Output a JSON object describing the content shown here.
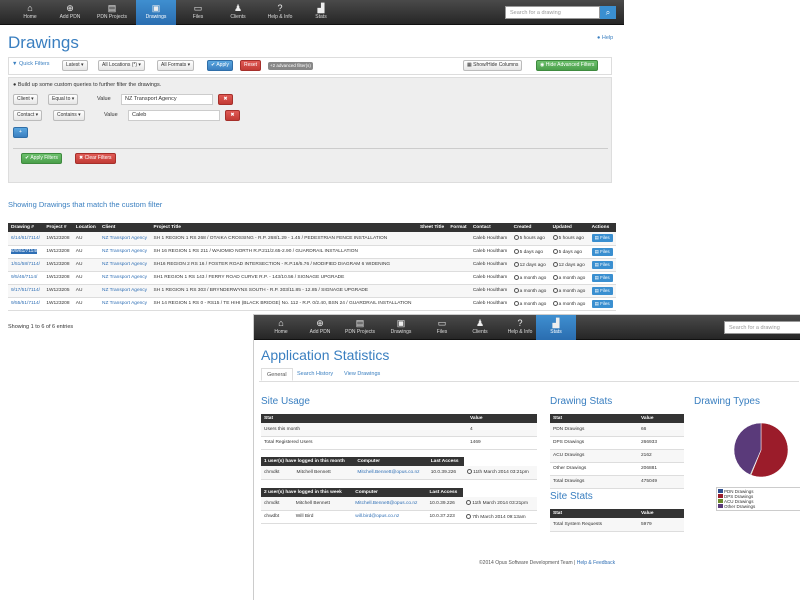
{
  "nav1": {
    "items": [
      {
        "label": "Home",
        "icon": "home-icon",
        "glyph": "⌂"
      },
      {
        "label": "Add PDN",
        "icon": "plus-circle-icon",
        "glyph": "⊕"
      },
      {
        "label": "PDN Projects",
        "icon": "document-icon",
        "glyph": "▤"
      },
      {
        "label": "Drawings",
        "icon": "folder-icon",
        "glyph": "▣"
      },
      {
        "label": "Files",
        "icon": "files-icon",
        "glyph": "▭"
      },
      {
        "label": "Clients",
        "icon": "users-icon",
        "glyph": "♟"
      },
      {
        "label": "Help & Info",
        "icon": "help-icon",
        "glyph": "?"
      },
      {
        "label": "Stats",
        "icon": "chart-icon",
        "glyph": "▟"
      }
    ],
    "search_placeholder": "Search for a drawing"
  },
  "drawings": {
    "title": "Drawings",
    "help": "Help",
    "quick_filters": "Quick Filters",
    "latest": "Latest",
    "all_locations": "All Locations (*)",
    "all_formats": "All Formats",
    "apply": "Apply",
    "reset": "Reset",
    "advanced_badge": "+2 advanced filter(s)",
    "show_hide": "Show/Hide Columns",
    "hide_advanced": "Hide Advanced Filters",
    "build_hint": "Build up some custom queries to further filter the drawings.",
    "filters": [
      {
        "field": "Client",
        "op": "Equal to",
        "value_label": "Value",
        "value": "NZ Transport Agency"
      },
      {
        "field": "Contact",
        "op": "Contains",
        "value_label": "Value",
        "value": "Caleb"
      }
    ],
    "apply_filters": "Apply Filters",
    "clear_filters": "Clear Filters",
    "showing_title": "Showing Drawings that match the custom filter",
    "columns": [
      "Drawing #",
      "Project #",
      "Location",
      "Client",
      "Project Title",
      "Sheet Title",
      "Format",
      "Contact",
      "Created",
      "Updated",
      "Actions"
    ],
    "rows": [
      {
        "d": "6/14/61/7114/",
        "p": "1W123208",
        "loc": "AU",
        "client": "NZ Transport Agency",
        "title": "SH 1 REGION 1 RS 268 / OTAIKA CROSSING - R.P. 268/1.29 - 1.45 / PEDESTRIAN FENCE INSTALLATION",
        "contact": "Caleb Houltham",
        "created": "5 hours ago",
        "updated": "5 hours ago",
        "action": "Files"
      },
      {
        "d": "6/9/61/7114/",
        "p": "1W123208",
        "loc": "AU",
        "client": "NZ Transport Agency",
        "title": "SH 16 REGION 1 RS 211 / WAIOMIO NORTH R.P.211/2.65-2.90 / GUARDRAIL INSTALLATION",
        "contact": "Caleb Houltham",
        "created": "5 days ago",
        "updated": "5 days ago",
        "action": "Files"
      },
      {
        "d": "1/51/58/7114/",
        "p": "1W123208",
        "loc": "AU",
        "client": "NZ Transport Agency",
        "title": "SH16 REGION 2 RS 16 / FOSTER ROAD INTERSECTION - R.P.16/5.76 / MODIFIED DIAGRAM 6 WIDENING",
        "contact": "Caleb Houltham",
        "created": "12 days ago",
        "updated": "12 days ago",
        "action": "Files"
      },
      {
        "d": "9/5/46/7114/",
        "p": "1W123208",
        "loc": "AU",
        "client": "NZ Transport Agency",
        "title": "SH1 REGION 1 RS 143 / FERRY ROAD CURVE R.P. - 143/10.56 / SIGNAGE UPGRADE",
        "contact": "Caleb Houltham",
        "created": "a month ago",
        "updated": "a month ago",
        "action": "Files"
      },
      {
        "d": "9/17/51/7114/",
        "p": "1W123205",
        "loc": "AU",
        "client": "NZ Transport Agency",
        "title": "SH 1 REGION 1 RS 303 / BRYNDERWYNS SOUTH - R.P. 303/11.85 - 12.85 / SIGNAGE UPGRADE",
        "contact": "Caleb Houltham",
        "created": "a month ago",
        "updated": "a month ago",
        "action": "Files"
      },
      {
        "d": "9/55/51/7114/",
        "p": "1W123208",
        "loc": "AU",
        "client": "NZ Transport Agency",
        "title": "SH 14 REGION 1 RS 0 - RS15 / TE HIHI (BLACK BRIDGE) No. 112 - R.P. 0/2.40, BSN 24 / GUARDRAIL INSTALLATION",
        "contact": "Caleb Houltham",
        "created": "a month ago",
        "updated": "a month ago",
        "action": "Files"
      }
    ],
    "showing_count": "Showing 1 to 6 of 6 entries"
  },
  "nav2": {
    "items": [
      {
        "label": "Home",
        "icon": "home-icon",
        "glyph": "⌂"
      },
      {
        "label": "Add PDN",
        "icon": "plus-circle-icon",
        "glyph": "⊕"
      },
      {
        "label": "PDN Projects",
        "icon": "document-icon",
        "glyph": "▤"
      },
      {
        "label": "Drawings",
        "icon": "folder-icon",
        "glyph": "▣"
      },
      {
        "label": "Files",
        "icon": "files-icon",
        "glyph": "▭"
      },
      {
        "label": "Clients",
        "icon": "users-icon",
        "glyph": "♟"
      },
      {
        "label": "Help & Info",
        "icon": "help-icon",
        "glyph": "?"
      },
      {
        "label": "Stats",
        "icon": "chart-icon",
        "glyph": "▟"
      }
    ],
    "search_placeholder": "Search for a drawing"
  },
  "stats": {
    "title": "Application Statistics",
    "tabs": [
      "General",
      "Search History",
      "View Drawings"
    ],
    "site_usage": "Site Usage",
    "usage_cols": [
      "Stat",
      "Value"
    ],
    "usage_rows": [
      [
        "Users this month",
        "4"
      ],
      [
        "Total Registered Users",
        "1469"
      ]
    ],
    "month_header": [
      "1 user(s) have logged in this month",
      "",
      "Computer",
      "Last Access"
    ],
    "month_rows": [
      [
        "chmdkt",
        "Mitchell Bennett",
        "Mitchell.Bennett@opus.co.nz",
        "10.0.39.226",
        "11th March 2014 03:21pm"
      ]
    ],
    "week_header": [
      "2 user(s) have logged in this week",
      "",
      "Computer",
      "Last Access"
    ],
    "week_rows": [
      [
        "chmdkt",
        "Mitchell Bennett",
        "Mitchell.Bennett@opus.co.nz",
        "10.0.39.226",
        "11th March 2014 03:21pm"
      ],
      [
        "chwdbt",
        "Will Bird",
        "will.bird@opus.co.nz",
        "10.0.37.223",
        "7th March 2014 09:13am"
      ]
    ],
    "drawing_stats": "Drawing Stats",
    "drawing_cols": [
      "Stat",
      "Value"
    ],
    "drawing_rows": [
      [
        "PDN Drawings",
        "66"
      ],
      [
        "DPS Drawings",
        "266933"
      ],
      [
        "ACU Drawings",
        "2162"
      ],
      [
        "Other Drawings",
        "206881"
      ],
      [
        "Total Drawings",
        "475049"
      ]
    ],
    "site_stats": "Site Stats",
    "site_cols": [
      "Stat",
      "Value"
    ],
    "site_rows": [
      [
        "Total System Requests",
        "5979"
      ]
    ],
    "drawing_types": "Drawing Types",
    "legend": [
      {
        "label": "PDN Drawings",
        "color": "#2f4f8f"
      },
      {
        "label": "DPS Drawings",
        "color": "#9b1c2a"
      },
      {
        "label": "ACU Drawings",
        "color": "#6b8a2a"
      },
      {
        "label": "Other Drawings",
        "color": "#5a3a7a"
      }
    ],
    "footer": "©2014 Opus Software Development Team",
    "footer_link": "Help & Feedback"
  },
  "chart_data": {
    "type": "pie",
    "title": "Drawing Types",
    "categories": [
      "PDN Drawings",
      "DPS Drawings",
      "ACU Drawings",
      "Other Drawings"
    ],
    "values": [
      66,
      266933,
      2162,
      206881
    ]
  }
}
